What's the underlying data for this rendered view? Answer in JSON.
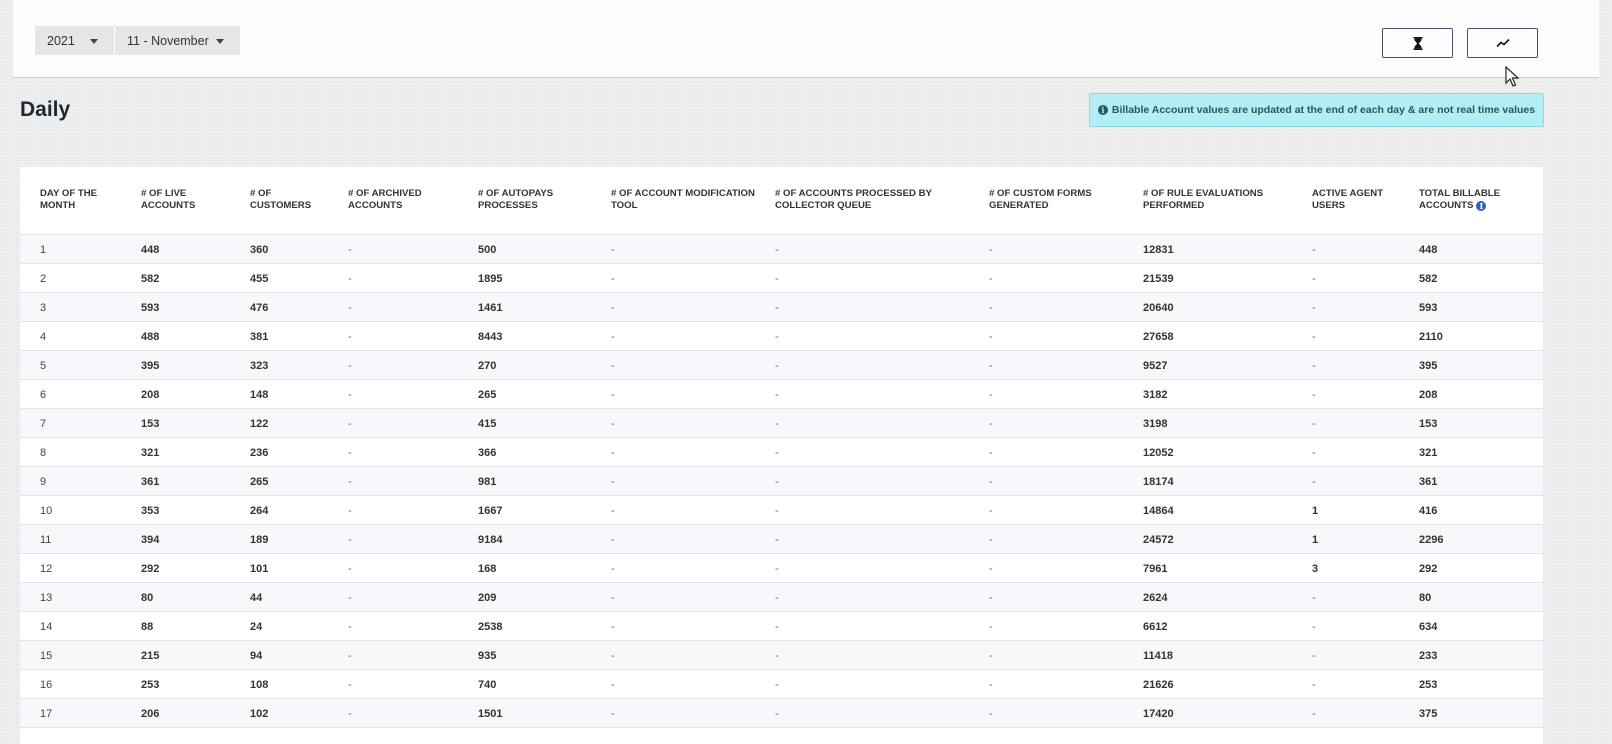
{
  "filters": {
    "year": "2021",
    "month": "11 - November"
  },
  "buttons": [
    {
      "name": "history-button",
      "icon": "hourglass-icon"
    },
    {
      "name": "trend-button",
      "icon": "trend-line-icon"
    }
  ],
  "page": {
    "title": "Daily"
  },
  "alert": {
    "text": "Billable Account values are updated at the end of each day & are not real time values",
    "icon": "info-circle-icon"
  },
  "table": {
    "columns": [
      "DAY OF THE MONTH",
      "# OF LIVE ACCOUNTS",
      "# OF CUSTOMERS",
      "# OF ARCHIVED ACCOUNTS",
      "# OF AUTOPAYS PROCESSES",
      "# OF ACCOUNT MODIFICATION TOOL",
      "# OF ACCOUNTS PROCESSED BY COLLECTOR QUEUE",
      "# OF CUSTOM FORMS GENERATED",
      "# OF RULE EVALUATIONS PERFORMED",
      "ACTIVE AGENT USERS",
      "TOTAL BILLABLE ACCOUNTS"
    ],
    "rows": [
      [
        "1",
        "448",
        "360",
        "-",
        "500",
        "-",
        "-",
        "-",
        "12831",
        "-",
        "448"
      ],
      [
        "2",
        "582",
        "455",
        "-",
        "1895",
        "-",
        "-",
        "-",
        "21539",
        "-",
        "582"
      ],
      [
        "3",
        "593",
        "476",
        "-",
        "1461",
        "-",
        "-",
        "-",
        "20640",
        "-",
        "593"
      ],
      [
        "4",
        "488",
        "381",
        "-",
        "8443",
        "-",
        "-",
        "-",
        "27658",
        "-",
        "2110"
      ],
      [
        "5",
        "395",
        "323",
        "-",
        "270",
        "-",
        "-",
        "-",
        "9527",
        "-",
        "395"
      ],
      [
        "6",
        "208",
        "148",
        "-",
        "265",
        "-",
        "-",
        "-",
        "3182",
        "-",
        "208"
      ],
      [
        "7",
        "153",
        "122",
        "-",
        "415",
        "-",
        "-",
        "-",
        "3198",
        "-",
        "153"
      ],
      [
        "8",
        "321",
        "236",
        "-",
        "366",
        "-",
        "-",
        "-",
        "12052",
        "-",
        "321"
      ],
      [
        "9",
        "361",
        "265",
        "-",
        "981",
        "-",
        "-",
        "-",
        "18174",
        "-",
        "361"
      ],
      [
        "10",
        "353",
        "264",
        "-",
        "1667",
        "-",
        "-",
        "-",
        "14864",
        "1",
        "416"
      ],
      [
        "11",
        "394",
        "189",
        "-",
        "9184",
        "-",
        "-",
        "-",
        "24572",
        "1",
        "2296"
      ],
      [
        "12",
        "292",
        "101",
        "-",
        "168",
        "-",
        "-",
        "-",
        "7961",
        "3",
        "292"
      ],
      [
        "13",
        "80",
        "44",
        "-",
        "209",
        "-",
        "-",
        "-",
        "2624",
        "-",
        "80"
      ],
      [
        "14",
        "88",
        "24",
        "-",
        "2538",
        "-",
        "-",
        "-",
        "6612",
        "-",
        "634"
      ],
      [
        "15",
        "215",
        "94",
        "-",
        "935",
        "-",
        "-",
        "-",
        "11418",
        "-",
        "233"
      ],
      [
        "16",
        "253",
        "108",
        "-",
        "740",
        "-",
        "-",
        "-",
        "21626",
        "-",
        "253"
      ],
      [
        "17",
        "206",
        "102",
        "-",
        "1501",
        "-",
        "-",
        "-",
        "17420",
        "-",
        "375"
      ]
    ]
  }
}
